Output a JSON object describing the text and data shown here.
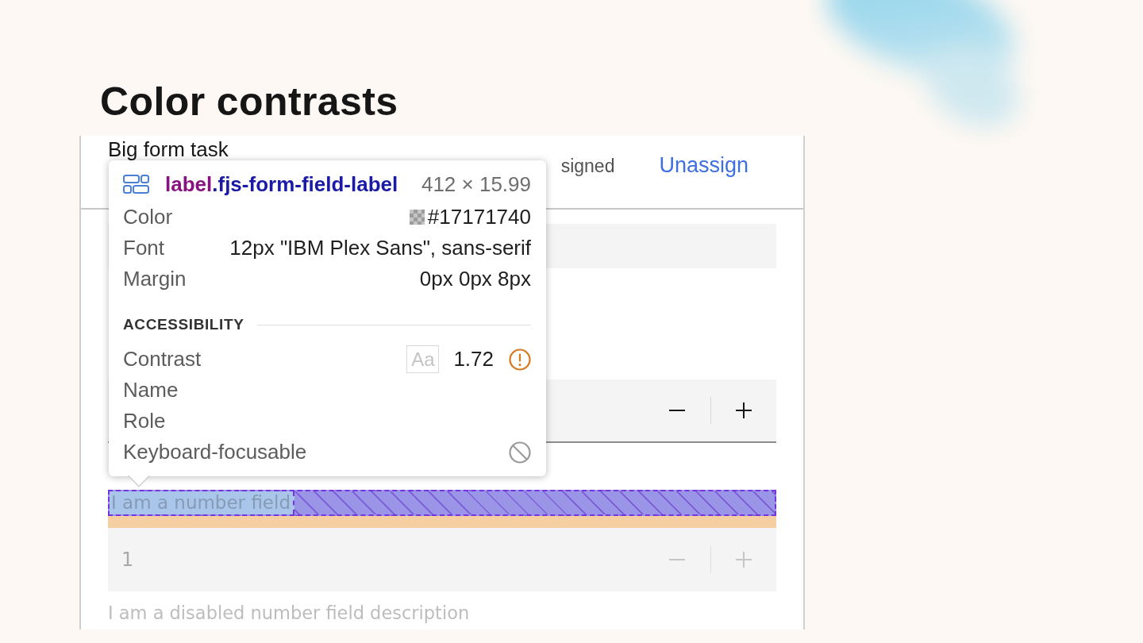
{
  "heading": "Color contrasts",
  "task_panel": {
    "title": "Big form task",
    "assignment_status": "signed",
    "unassign_link": "Unassign",
    "fields": [
      {
        "kind": "text"
      },
      {
        "kind": "number",
        "disabled": false
      },
      {
        "kind": "number",
        "disabled": true,
        "label": "I am a number field",
        "inspected": true,
        "value": "1",
        "description": "I am a disabled number field description"
      }
    ]
  },
  "inspector_tooltip": {
    "tag": "label",
    "class_name": ".fjs-form-field-label",
    "size": "412 × 15.99",
    "properties": [
      {
        "kind": "color",
        "name": "Color",
        "value": "#17171740"
      },
      {
        "kind": "text",
        "name": "Font",
        "value": "12px \"IBM Plex Sans\", sans-serif"
      },
      {
        "kind": "text",
        "name": "Margin",
        "value": "0px 0px 8px"
      }
    ],
    "section_title": "ACCESSIBILITY",
    "accessibility": [
      {
        "kind": "contrast",
        "name": "Contrast",
        "sample": "Aa",
        "value": "1.72",
        "warning": true
      },
      {
        "kind": "plain",
        "name": "Name"
      },
      {
        "kind": "plain",
        "name": "Role"
      },
      {
        "kind": "focusable",
        "name": "Keyboard-focusable",
        "focusable": false
      }
    ]
  }
}
